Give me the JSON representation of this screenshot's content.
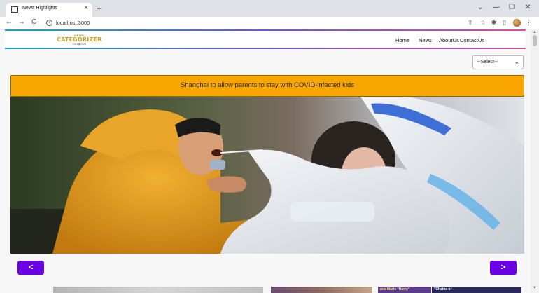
{
  "browser": {
    "tab_title": "News Highlights",
    "tab_close": "×",
    "new_tab": "+",
    "url": "localhost:3000",
    "controls": {
      "minimize": "—",
      "restore": "❐",
      "close": "✕",
      "chevron": "⌄"
    },
    "nav": {
      "back": "←",
      "forward": "→",
      "reload": "C"
    }
  },
  "site": {
    "logo": {
      "top": "NEWS",
      "main": "CATEGORIZER",
      "sub": "2022 ▮ 2023"
    },
    "nav": [
      "Home",
      "News",
      "AboutUs",
      "ContactUs"
    ],
    "select": {
      "value": "--Select--",
      "arrow": "⌄"
    }
  },
  "carousel": {
    "headline": "Shanghai to allow parents to stay with COVID-infected kids",
    "prev": "<",
    "next": ">",
    "image_icon": "photo-covid-test"
  },
  "thumbnails": [
    {
      "caption": ""
    },
    {
      "caption": ""
    },
    {
      "caption": "ana Marie \"Harry\""
    },
    {
      "caption": "\"Chains of"
    }
  ],
  "colors": {
    "banner": "#f8a500",
    "arrow_button": "#6a00e6",
    "accent_line_start": "#1ca3c4",
    "accent_line_end": "#d64fa0"
  }
}
